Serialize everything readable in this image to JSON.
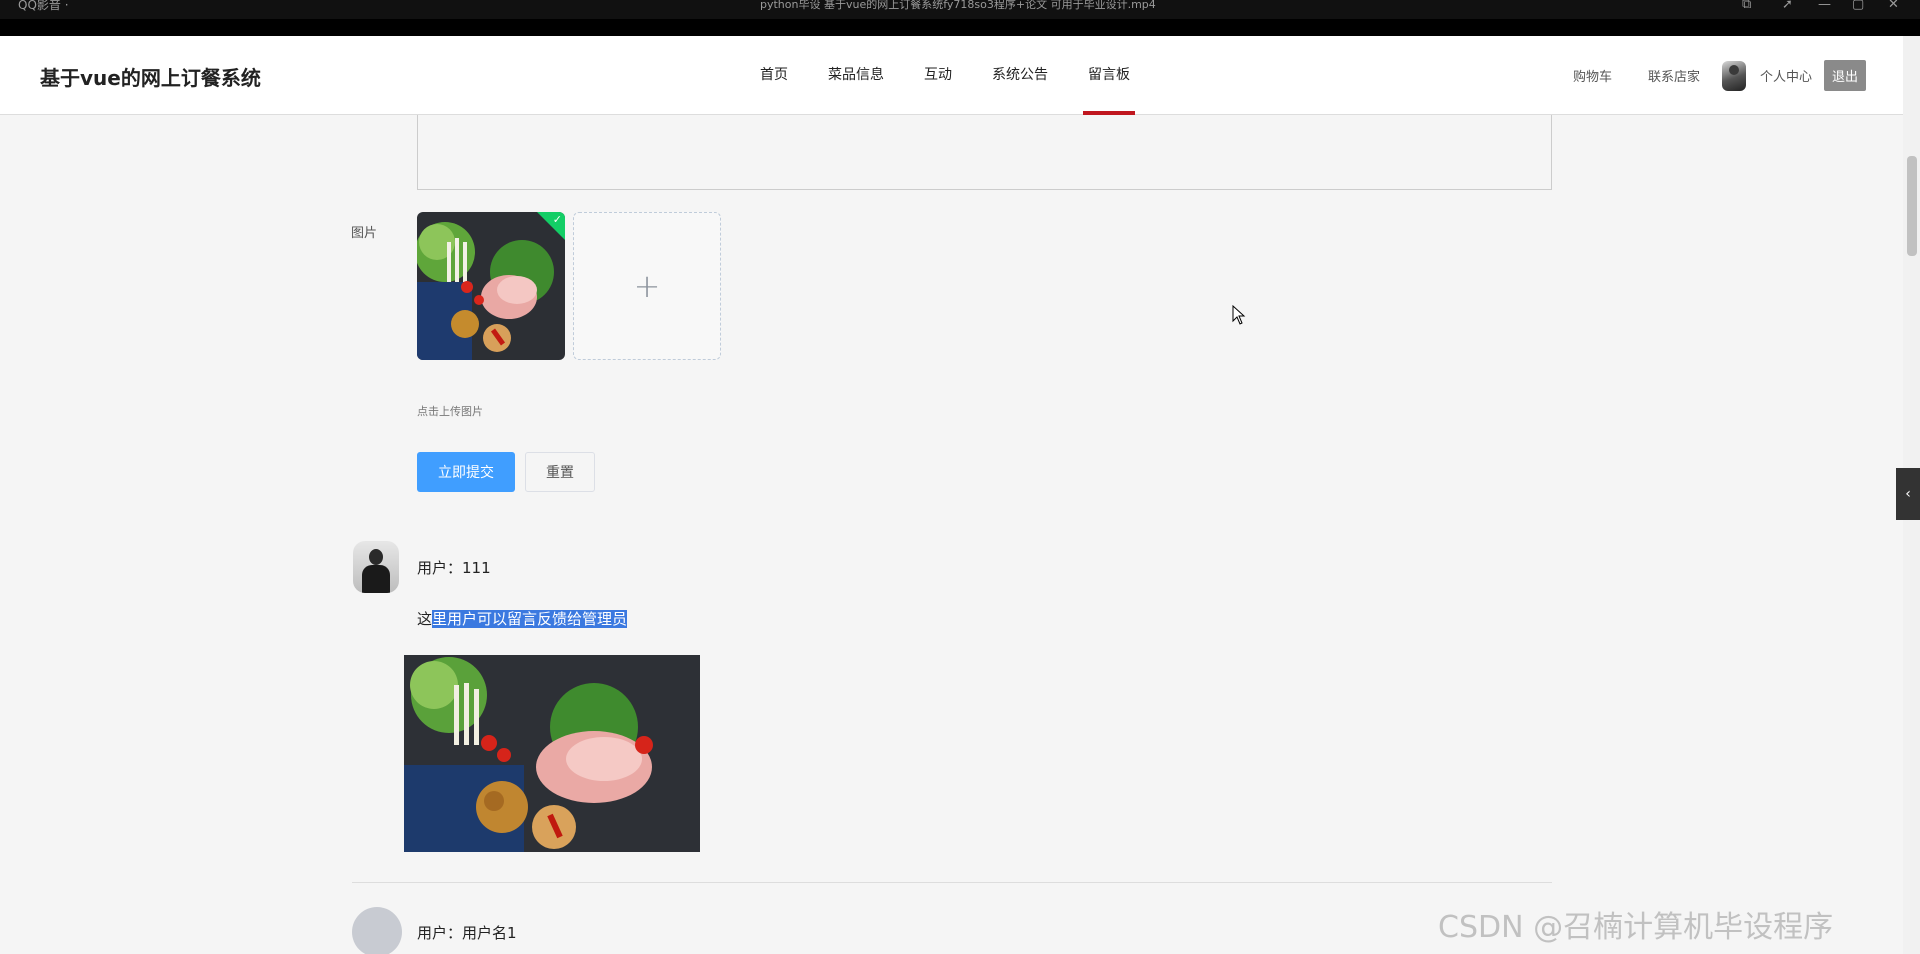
{
  "player": {
    "app_name": "QQ影音 ·",
    "window_title": "python毕设 基于vue的网上订餐系统fy718so3程序+论文 可用于毕业设计.mp4"
  },
  "header": {
    "logo": "基于vue的网上订餐系统",
    "nav": [
      "首页",
      "菜品信息",
      "互动",
      "系统公告",
      "留言板"
    ],
    "active_nav": "留言板",
    "cart": "购物车",
    "contact": "联系店家",
    "profile": "个人中心",
    "logout": "退出"
  },
  "form": {
    "image_label": "图片",
    "upload_hint": "点击上传图片",
    "upload_plus": "+",
    "submit_label": "立即提交",
    "reset_label": "重置"
  },
  "comments": [
    {
      "user": "用户：111",
      "text_prefix": "这",
      "text_selected": "里用户可以留言反馈给管理员"
    },
    {
      "user": "用户：用户名1"
    }
  ],
  "watermark": "CSDN @召楠计算机毕设程序",
  "colors": {
    "primary": "#409eff",
    "nav_active": "#c0171f",
    "upload_success": "#13ce66"
  }
}
